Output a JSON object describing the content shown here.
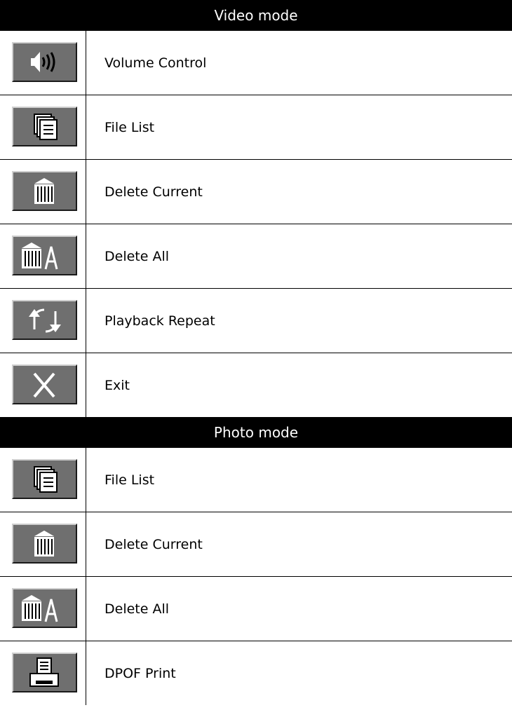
{
  "sections": [
    {
      "title": "Video mode",
      "items": [
        {
          "icon": "volume-icon",
          "label": "Volume Control"
        },
        {
          "icon": "file-list-icon",
          "label": "File List"
        },
        {
          "icon": "trash-icon",
          "label": "Delete Current"
        },
        {
          "icon": "trash-all-icon",
          "label": "Delete All"
        },
        {
          "icon": "repeat-icon",
          "label": "Playback Repeat"
        },
        {
          "icon": "close-icon",
          "label": "Exit"
        }
      ]
    },
    {
      "title": "Photo mode",
      "items": [
        {
          "icon": "file-list-icon",
          "label": "File List"
        },
        {
          "icon": "trash-icon",
          "label": "Delete Current"
        },
        {
          "icon": "trash-all-icon",
          "label": "Delete All"
        },
        {
          "icon": "printer-icon",
          "label": "DPOF Print"
        }
      ]
    }
  ],
  "colors": {
    "header_bg": "#000000",
    "header_text": "#ffffff",
    "button_face": "#6f6f6f"
  }
}
